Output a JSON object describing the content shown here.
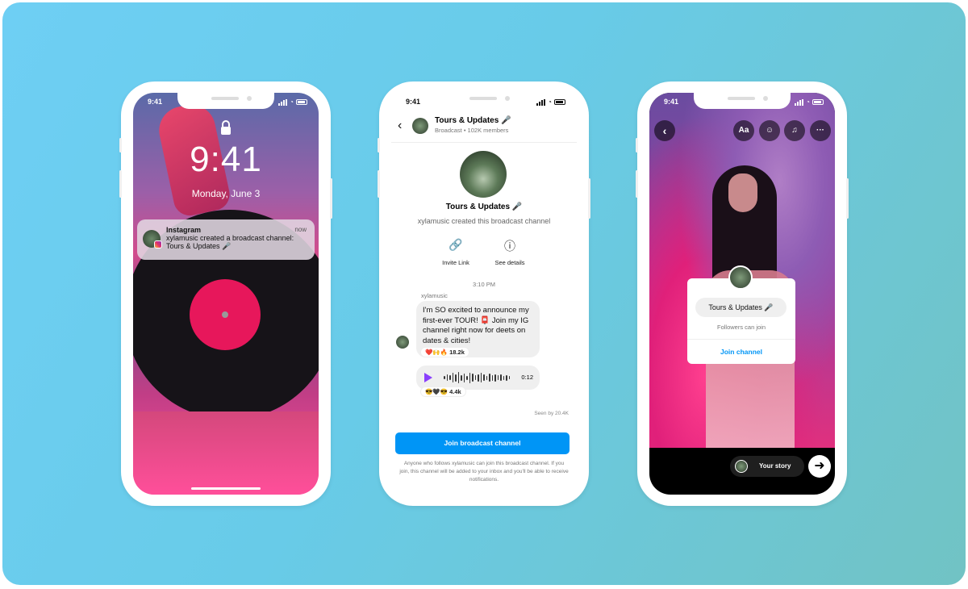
{
  "phones": {
    "lockscreen": {
      "status_time": "9:41",
      "clock": "9:41",
      "date": "Monday, June 3",
      "notification": {
        "app": "Instagram",
        "when": "now",
        "text": "xylamusic created a broadcast channel: Tours & Updates 🎤"
      }
    },
    "channel": {
      "status_time": "9:41",
      "header": {
        "title": "Tours & Updates 🎤",
        "subtitle": "Broadcast • 102K members"
      },
      "channel_title": "Tours & Updates 🎤",
      "created_text": "xylamusic created this broadcast channel",
      "actions": [
        {
          "icon": "link-icon",
          "label": "Invite Link"
        },
        {
          "icon": "info-icon",
          "label": "See details"
        }
      ],
      "timestamp": "3:10 PM",
      "sender": "xylamusic",
      "message": "I'm SO excited to announce my first-ever TOUR! 📮 Join my IG channel right now for deets on dates & cities!",
      "message_reactions": "❤️🙌🔥 18.2k",
      "audio": {
        "duration": "0:12",
        "reactions": "😎🖤😎 4.4k"
      },
      "seen": "Seen by 20.4K",
      "join_button": "Join broadcast channel",
      "disclaimer": "Anyone who follows xylamusic can join this broadcast channel. If you join, this channel will be added to your inbox and you'll be able to receive notifications."
    },
    "story": {
      "status_time": "9:41",
      "tools": [
        "Aa",
        "☺",
        "♫",
        "···"
      ],
      "sticker": {
        "channel": "Tours & Updates 🎤",
        "note": "Followers can join",
        "join": "Join channel"
      },
      "your_story": "Your story",
      "accent": "#0095f6"
    }
  }
}
